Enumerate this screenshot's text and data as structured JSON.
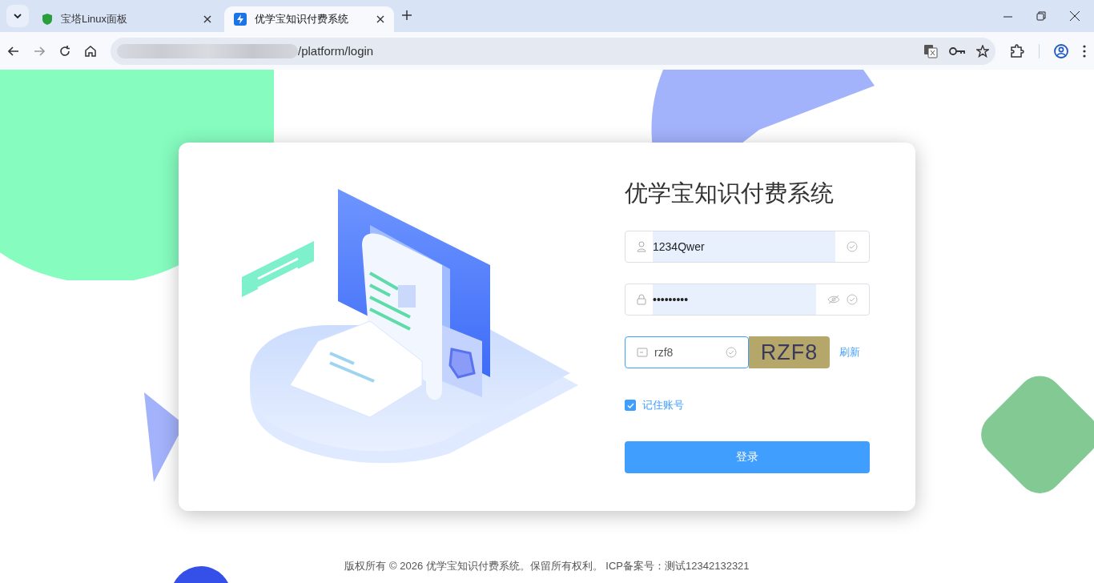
{
  "browser": {
    "tabs": [
      {
        "title": "宝塔Linux面板",
        "selected": false
      },
      {
        "title": "优学宝知识付费系统",
        "selected": true
      }
    ],
    "address": "/platform/login"
  },
  "login": {
    "title": "优学宝知识付费系统",
    "username": {
      "value": "1234Qwer"
    },
    "password": {
      "value": "•••••••••"
    },
    "captcha": {
      "value": "rzf8",
      "image_text": "RZF8",
      "refresh": "刷新"
    },
    "remember": {
      "label": "记住账号",
      "checked": true
    },
    "submit": "登录"
  },
  "footer": "版权所有 © 2026 优学宝知识付费系统。保留所有权利。 ICP备案号：测试12342132321"
}
